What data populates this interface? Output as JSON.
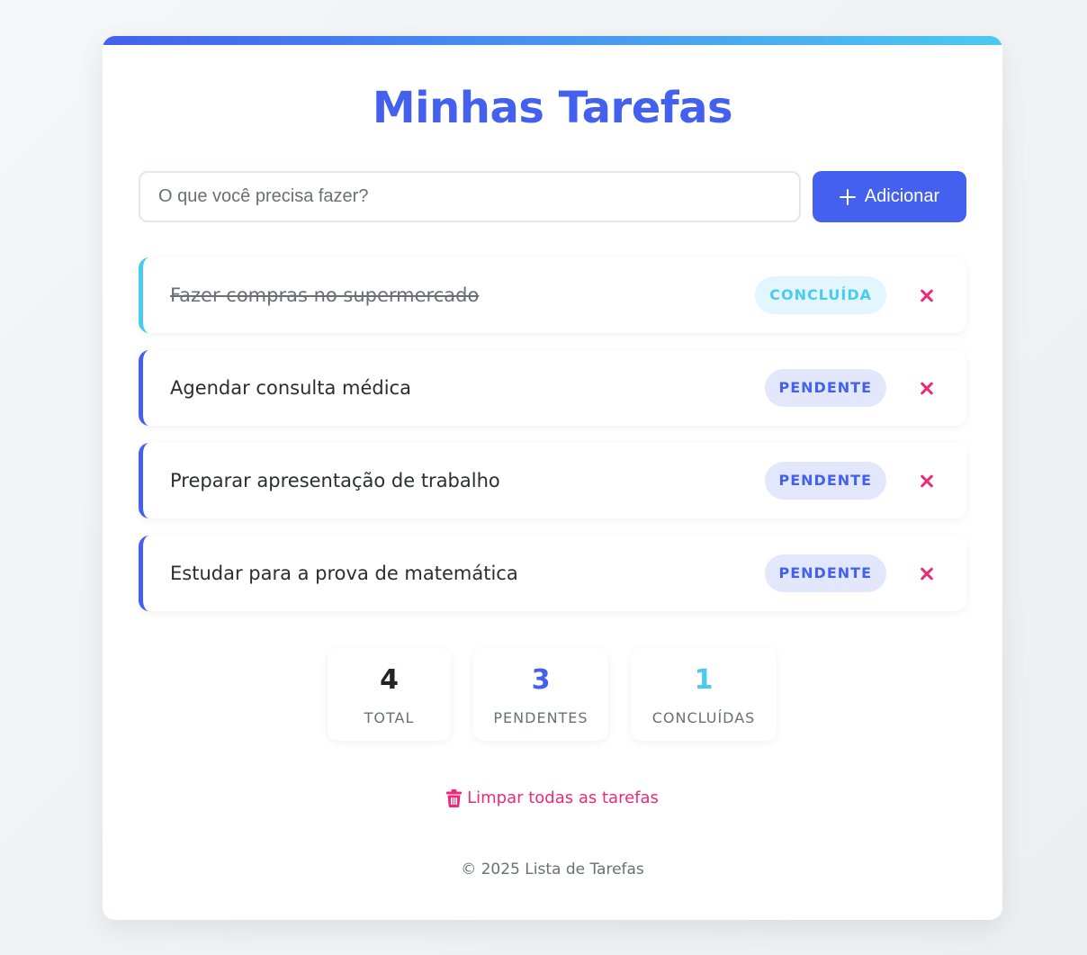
{
  "app": {
    "title": "Minhas Tarefas",
    "accent_color": "#4361ee",
    "secondary_color": "#4cc9f0",
    "danger_color": "#ea2a7a"
  },
  "add_form": {
    "placeholder": "O que você precisa fazer?",
    "value": "",
    "button_label": "Adicionar",
    "button_icon": "plus-icon"
  },
  "tasks": [
    {
      "text": "Fazer compras no supermercado",
      "status": "CONCLUÍDA",
      "done": true
    },
    {
      "text": "Agendar consulta médica",
      "status": "PENDENTE",
      "done": false
    },
    {
      "text": "Preparar apresentação de trabalho",
      "status": "PENDENTE",
      "done": false
    },
    {
      "text": "Estudar para a prova de matemática",
      "status": "PENDENTE",
      "done": false
    }
  ],
  "stats": {
    "total": {
      "value": "4",
      "label": "TOTAL",
      "color": "#212529"
    },
    "pending": {
      "value": "3",
      "label": "PENDENTES",
      "color": "#4361ee"
    },
    "completed": {
      "value": "1",
      "label": "CONCLUÍDAS",
      "color": "#4cc9f0"
    }
  },
  "clear_all": {
    "label": "Limpar todas as tarefas",
    "icon": "trash-icon"
  },
  "footer": {
    "text": "© 2025 Lista de Tarefas"
  }
}
